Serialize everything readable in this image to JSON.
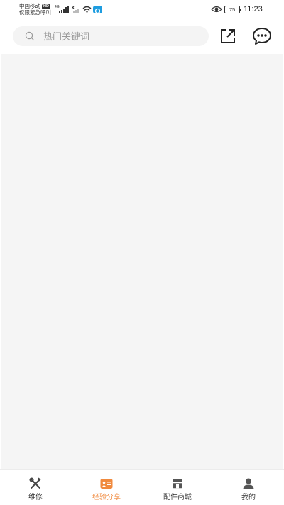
{
  "status_bar": {
    "carrier_line1": "中国移动",
    "carrier_hd": "HD",
    "carrier_line2": "仅限紧急呼叫",
    "network": "4G",
    "battery": "75",
    "time": "11:23"
  },
  "search": {
    "placeholder": "热门关键词"
  },
  "nav": {
    "items": [
      {
        "label": "维修",
        "icon": "tools-icon"
      },
      {
        "label": "经验分享",
        "icon": "id-card-icon",
        "active": true
      },
      {
        "label": "配件商城",
        "icon": "store-icon"
      },
      {
        "label": "我的",
        "icon": "user-icon"
      }
    ]
  },
  "colors": {
    "accent": "#f08a3e",
    "content_bg": "#f5f5f5",
    "search_bg": "#f4f4f4"
  }
}
